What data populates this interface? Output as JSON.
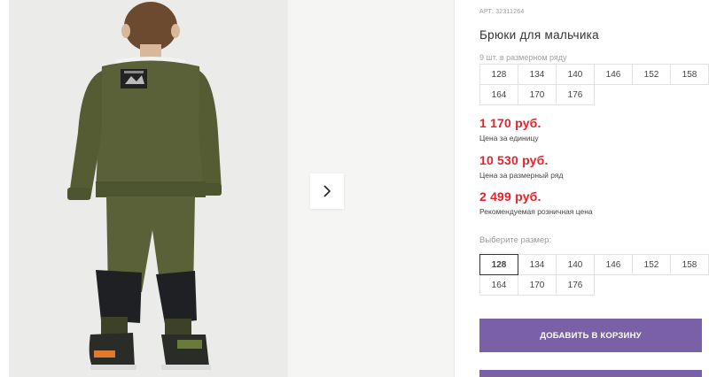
{
  "product": {
    "sku": "АРТ: 32311264",
    "title": "Брюки для мальчика",
    "size_note": "9 шт. в размерном ряду"
  },
  "size_row": [
    "128",
    "134",
    "140",
    "146",
    "152",
    "158",
    "164",
    "170",
    "176"
  ],
  "prices": {
    "unit": {
      "value": "1 170 руб.",
      "label": "Цена за единицу"
    },
    "row": {
      "value": "10 530 руб.",
      "label": "Цена за размерный ряд"
    },
    "retail": {
      "value": "2 499 руб.",
      "label": "Рекомендуемая розничная цена"
    }
  },
  "size_select": {
    "label": "Выберите размер:",
    "options": [
      "128",
      "134",
      "140",
      "146",
      "152",
      "158",
      "164",
      "170",
      "176"
    ],
    "selected": "128"
  },
  "buttons": {
    "add_to_cart": "ДОБАВИТЬ В КОРЗИНУ"
  },
  "gallery": {
    "next_icon": "chevron-right-icon"
  },
  "colors": {
    "accent": "#7a61a7",
    "price": "#e3232b"
  }
}
